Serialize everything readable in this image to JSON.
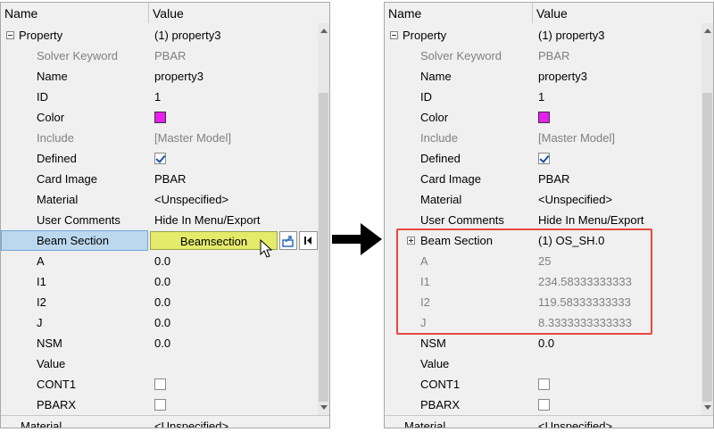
{
  "left": {
    "header": {
      "name": "Name",
      "value": "Value"
    },
    "rows": [
      {
        "name": "Property",
        "value": "(1) property3"
      },
      {
        "name": "Solver Keyword",
        "value": "PBAR"
      },
      {
        "name": "Name",
        "value": "property3"
      },
      {
        "name": "ID",
        "value": "1"
      },
      {
        "name": "Color",
        "value": ""
      },
      {
        "name": "Include",
        "value": "[Master Model]"
      },
      {
        "name": "Defined",
        "value": ""
      },
      {
        "name": "Card Image",
        "value": "PBAR"
      },
      {
        "name": "Material",
        "value": "<Unspecified>"
      },
      {
        "name": "User Comments",
        "value": "Hide In Menu/Export"
      },
      {
        "name": "Beam Section",
        "value": "Beamsection"
      },
      {
        "name": "A",
        "value": "0.0"
      },
      {
        "name": "I1",
        "value": "0.0"
      },
      {
        "name": "I2",
        "value": "0.0"
      },
      {
        "name": "J",
        "value": "0.0"
      },
      {
        "name": "NSM",
        "value": "0.0"
      },
      {
        "name": "Value",
        "value": ""
      },
      {
        "name": "CONT1",
        "value": ""
      },
      {
        "name": "PBARX",
        "value": ""
      },
      {
        "name": "Material",
        "value": "<Unspecified>"
      }
    ]
  },
  "right": {
    "header": {
      "name": "Name",
      "value": "Value"
    },
    "rows": [
      {
        "name": "Property",
        "value": "(1) property3"
      },
      {
        "name": "Solver Keyword",
        "value": "PBAR"
      },
      {
        "name": "Name",
        "value": "property3"
      },
      {
        "name": "ID",
        "value": "1"
      },
      {
        "name": "Color",
        "value": ""
      },
      {
        "name": "Include",
        "value": "[Master Model]"
      },
      {
        "name": "Defined",
        "value": ""
      },
      {
        "name": "Card Image",
        "value": "PBAR"
      },
      {
        "name": "Material",
        "value": "<Unspecified>"
      },
      {
        "name": "User Comments",
        "value": "Hide In Menu/Export"
      },
      {
        "name": "Beam Section",
        "value": "(1) OS_SH.0"
      },
      {
        "name": "A",
        "value": "25"
      },
      {
        "name": "I1",
        "value": "234.58333333333"
      },
      {
        "name": "I2",
        "value": "119.58333333333"
      },
      {
        "name": "J",
        "value": "8.3333333333333"
      },
      {
        "name": "NSM",
        "value": "0.0"
      },
      {
        "name": "Value",
        "value": ""
      },
      {
        "name": "CONT1",
        "value": ""
      },
      {
        "name": "PBARX",
        "value": ""
      },
      {
        "name": "Material",
        "value": "<Unspecified>"
      }
    ]
  },
  "colors": {
    "highlight_box": "#e8473f",
    "color_swatch": "#e81ef0",
    "beam_button": "#e4ea6a",
    "selected_row": "#bcd8ee"
  },
  "icons": [
    "expand-minus-icon",
    "expand-plus-icon",
    "checkbox-checked-icon",
    "checkbox-icon",
    "update-icon",
    "first-icon",
    "cursor-icon",
    "right-arrow-icon"
  ]
}
